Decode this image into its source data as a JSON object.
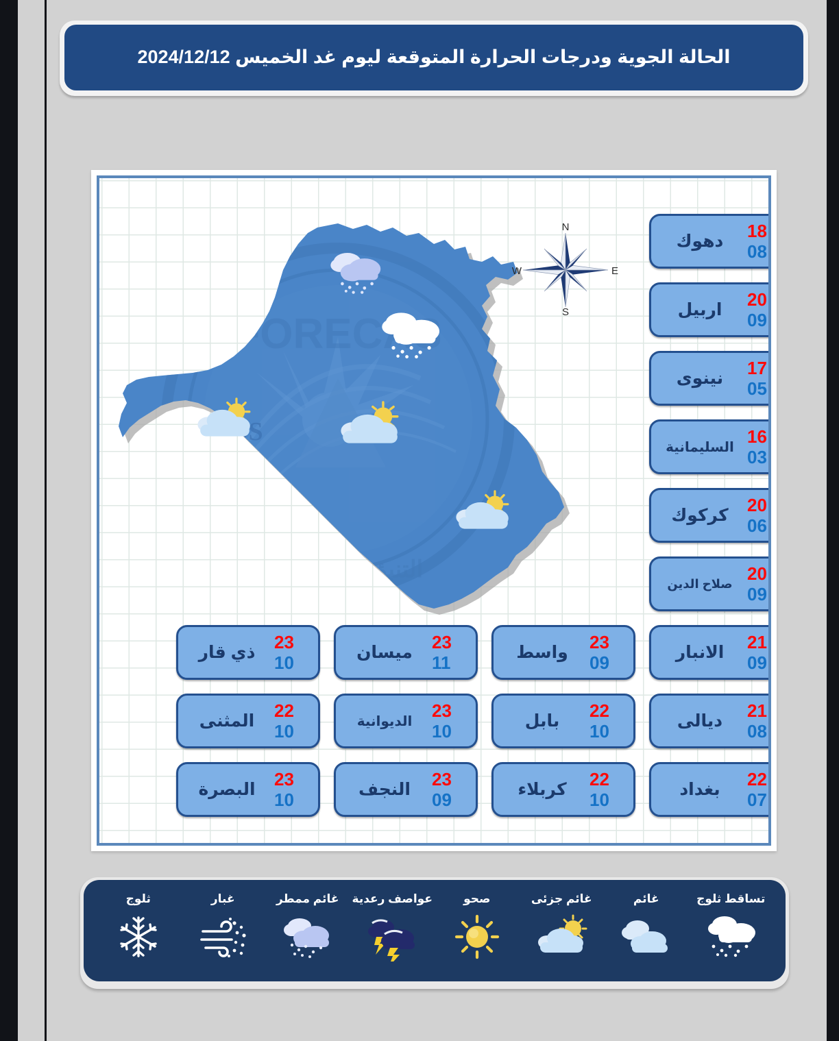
{
  "header": {
    "title": "الحالة الجوية ودرجات الحرارة المتوقعة ليوم غد الخميس  2024/12/12"
  },
  "compass": {
    "north": "N",
    "south": "S",
    "east": "E",
    "west": "W"
  },
  "colors": {
    "title_bar": "#214a84",
    "card_fill": "#7eb0e6",
    "card_border": "#24508f",
    "temp_max": "#fb0b0b",
    "temp_min": "#1572c6",
    "legend_bar": "#1d3a63",
    "map_fill": "#4a85c8",
    "page_background": "#d2d2d2"
  },
  "right_column": [
    {
      "name": "دهوك",
      "max": "18",
      "min": "08"
    },
    {
      "name": "اربيل",
      "max": "20",
      "min": "09"
    },
    {
      "name": "نينوى",
      "max": "17",
      "min": "05"
    },
    {
      "name": "السليمانية",
      "max": "16",
      "min": "03"
    },
    {
      "name": "كركوك",
      "max": "20",
      "min": "06"
    },
    {
      "name": "صلاح الدين",
      "max": "20",
      "min": "09"
    }
  ],
  "grid_rows": [
    [
      {
        "name": "الانبار",
        "max": "21",
        "min": "09"
      },
      {
        "name": "واسط",
        "max": "23",
        "min": "09"
      },
      {
        "name": "ميسان",
        "max": "23",
        "min": "11"
      },
      {
        "name": "ذي قار",
        "max": "23",
        "min": "10"
      }
    ],
    [
      {
        "name": "ديالى",
        "max": "21",
        "min": "08"
      },
      {
        "name": "بابل",
        "max": "22",
        "min": "10"
      },
      {
        "name": "الديوانية",
        "max": "23",
        "min": "10"
      },
      {
        "name": "المثنى",
        "max": "22",
        "min": "10"
      }
    ],
    [
      {
        "name": "بغداد",
        "max": "22",
        "min": "07"
      },
      {
        "name": "كربلاء",
        "max": "22",
        "min": "10"
      },
      {
        "name": "النجف",
        "max": "23",
        "min": "09"
      },
      {
        "name": "البصرة",
        "max": "23",
        "min": "10"
      }
    ]
  ],
  "legend": [
    {
      "label": "تساقط ثلوج",
      "icon": "snow-cloud-icon"
    },
    {
      "label": "غائم",
      "icon": "cloudy-icon"
    },
    {
      "label": "غائم جزئى",
      "icon": "partly-cloudy-icon"
    },
    {
      "label": "صحو",
      "icon": "sun-icon"
    },
    {
      "label": "عواصف رعدية",
      "icon": "thunderstorm-icon"
    },
    {
      "label": "غائم ممطر",
      "icon": "rain-cloud-icon"
    },
    {
      "label": "غبار",
      "icon": "dust-wind-icon"
    },
    {
      "label": "ثلوج",
      "icon": "snowflake-icon"
    }
  ],
  "map_icons": [
    {
      "icon": "rain-cloud-icon",
      "region": "north-west"
    },
    {
      "icon": "snow-cloud-icon",
      "region": "north-east"
    },
    {
      "icon": "partly-cloudy-icon",
      "region": "west"
    },
    {
      "icon": "partly-cloudy-icon",
      "region": "center"
    },
    {
      "icon": "partly-cloudy-icon",
      "region": "south-east"
    }
  ]
}
